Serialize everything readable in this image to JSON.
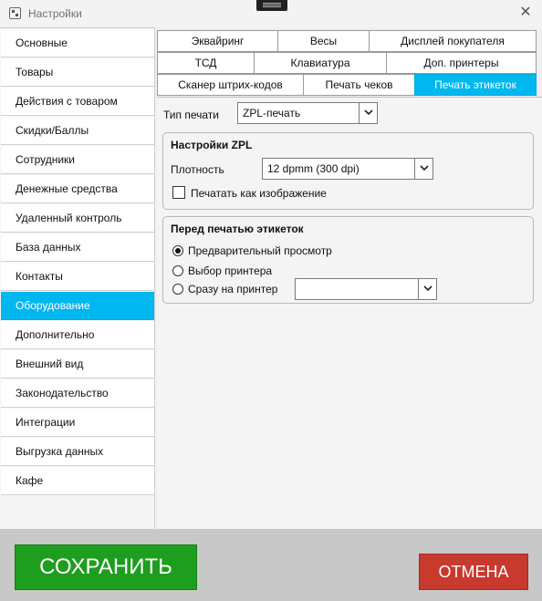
{
  "window": {
    "title": "Настройки",
    "close_glyph": "✕"
  },
  "sidebar": {
    "items": [
      {
        "label": "Основные"
      },
      {
        "label": "Товары"
      },
      {
        "label": "Действия с товаром"
      },
      {
        "label": "Скидки/Баллы"
      },
      {
        "label": "Сотрудники"
      },
      {
        "label": "Денежные средства"
      },
      {
        "label": "Удаленный контроль"
      },
      {
        "label": "База данных"
      },
      {
        "label": "Контакты"
      },
      {
        "label": "Оборудование",
        "active": true
      },
      {
        "label": "Дополнительно"
      },
      {
        "label": "Внешний вид"
      },
      {
        "label": "Законодательство"
      },
      {
        "label": "Интеграции"
      },
      {
        "label": "Выгрузка данных"
      },
      {
        "label": "Кафе"
      }
    ]
  },
  "tabs": {
    "row1": [
      "Эквайринг",
      "Весы",
      "Дисплей покупателя"
    ],
    "row2": [
      "ТСД",
      "Клавиатура",
      "Доп. принтеры"
    ],
    "row3": [
      "Сканер штрих-кодов",
      "Печать чеков",
      "Печать этикеток"
    ],
    "active": "Печать этикеток"
  },
  "content": {
    "print_type_label": "Тип печати",
    "print_type_value": "ZPL-печать",
    "zpl_group": {
      "title": "Настройки ZPL",
      "density_label": "Плотность",
      "density_value": "12 dpmm (300 dpi)",
      "print_as_image_label": "Печатать как изображение",
      "print_as_image_checked": false
    },
    "before_print_group": {
      "title": "Перед печатью этикеток",
      "options": [
        {
          "label": "Предварительный просмотр",
          "checked": true
        },
        {
          "label": "Выбор принтера",
          "checked": false
        },
        {
          "label": "Сразу на принтер",
          "checked": false
        }
      ],
      "printer_value": ""
    }
  },
  "footer": {
    "save_label": "СОХРАНИТЬ",
    "cancel_label": "ОТМЕНА"
  },
  "colors": {
    "accent": "#00b7ef",
    "save": "#1e9e1e",
    "cancel": "#c8392e"
  }
}
